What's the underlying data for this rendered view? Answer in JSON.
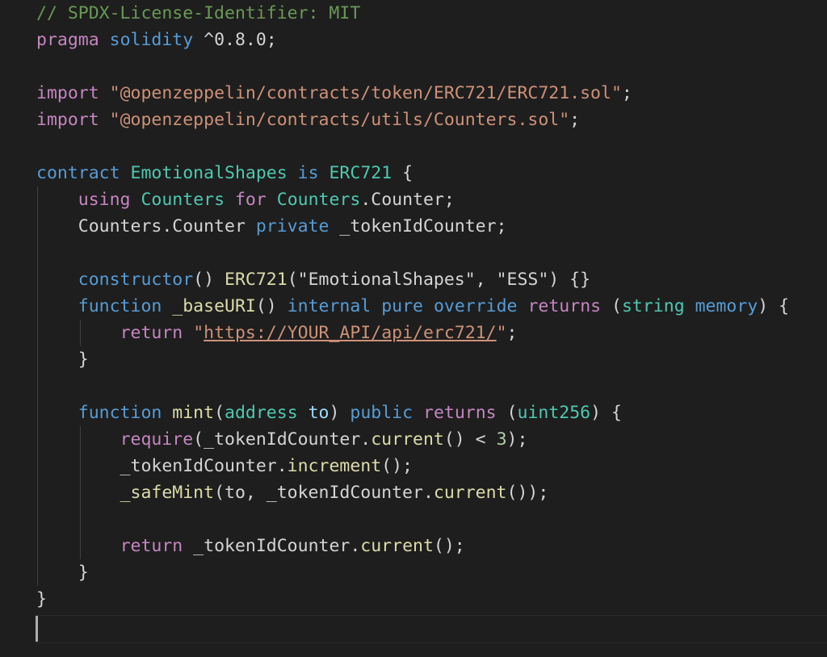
{
  "editor": {
    "language": "solidity",
    "colors": {
      "background": "#1e1e1e",
      "comment": "#6a9955",
      "keyword": "#c586c0",
      "storage": "#569cd6",
      "type": "#4ec9b0",
      "function": "#dcdcaa",
      "string": "#ce9178",
      "number": "#b5cea8",
      "variable": "#9cdcfe",
      "plain": "#d4d4d4"
    },
    "lines": [
      [
        [
          "cm",
          "// SPDX-License-Identifier: MIT"
        ]
      ],
      [
        [
          "kw",
          "pragma"
        ],
        [
          "pl",
          " "
        ],
        [
          "bl",
          "solidity"
        ],
        [
          "pl",
          " ^0.8.0;"
        ]
      ],
      [],
      [
        [
          "kw",
          "import"
        ],
        [
          "pl",
          " "
        ],
        [
          "st",
          "\"@openzeppelin/contracts/token/ERC721/ERC721.sol\""
        ],
        [
          "pl",
          ";"
        ]
      ],
      [
        [
          "kw",
          "import"
        ],
        [
          "pl",
          " "
        ],
        [
          "st",
          "\"@openzeppelin/contracts/utils/Counters.sol\""
        ],
        [
          "pl",
          ";"
        ]
      ],
      [],
      [
        [
          "bl",
          "contract"
        ],
        [
          "pl",
          " "
        ],
        [
          "ty",
          "EmotionalShapes"
        ],
        [
          "pl",
          " "
        ],
        [
          "bl",
          "is"
        ],
        [
          "pl",
          " "
        ],
        [
          "ty",
          "ERC721"
        ],
        [
          "pl",
          " {"
        ]
      ],
      [
        [
          "pl",
          "    "
        ],
        [
          "kw",
          "using"
        ],
        [
          "pl",
          " "
        ],
        [
          "ty",
          "Counters"
        ],
        [
          "pl",
          " "
        ],
        [
          "kw",
          "for"
        ],
        [
          "pl",
          " "
        ],
        [
          "ty",
          "Counters"
        ],
        [
          "pl",
          ".Counter;"
        ]
      ],
      [
        [
          "pl",
          "    Counters.Counter "
        ],
        [
          "bl",
          "private"
        ],
        [
          "pl",
          " _tokenIdCounter;"
        ]
      ],
      [],
      [
        [
          "pl",
          "    "
        ],
        [
          "bl",
          "constructor"
        ],
        [
          "pl",
          "() "
        ],
        [
          "fn",
          "ERC721"
        ],
        [
          "pl",
          "(\"EmotionalShapes\", \"ESS\") {}"
        ]
      ],
      [
        [
          "pl",
          "    "
        ],
        [
          "bl",
          "function"
        ],
        [
          "pl",
          " "
        ],
        [
          "fn",
          "_baseURI"
        ],
        [
          "pl",
          "() "
        ],
        [
          "bl",
          "internal"
        ],
        [
          "pl",
          " "
        ],
        [
          "bl",
          "pure"
        ],
        [
          "pl",
          " "
        ],
        [
          "bl",
          "override"
        ],
        [
          "pl",
          " "
        ],
        [
          "kw",
          "returns"
        ],
        [
          "pl",
          " ("
        ],
        [
          "ty",
          "string"
        ],
        [
          "pl",
          " "
        ],
        [
          "bl",
          "memory"
        ],
        [
          "pl",
          ") {"
        ]
      ],
      [
        [
          "pl",
          "        "
        ],
        [
          "kw",
          "return"
        ],
        [
          "pl",
          " "
        ],
        [
          "st",
          "\""
        ],
        [
          "st ul",
          "https://YOUR_API/api/erc721/"
        ],
        [
          "st",
          "\""
        ],
        [
          "pl",
          ";"
        ]
      ],
      [
        [
          "pl",
          "    }"
        ]
      ],
      [],
      [
        [
          "pl",
          "    "
        ],
        [
          "bl",
          "function"
        ],
        [
          "pl",
          " "
        ],
        [
          "fn",
          "mint"
        ],
        [
          "pl",
          "("
        ],
        [
          "ty",
          "address"
        ],
        [
          "pl",
          " "
        ],
        [
          "va",
          "to"
        ],
        [
          "pl",
          ") "
        ],
        [
          "bl",
          "public"
        ],
        [
          "pl",
          " "
        ],
        [
          "kw",
          "returns"
        ],
        [
          "pl",
          " ("
        ],
        [
          "ty",
          "uint256"
        ],
        [
          "pl",
          ") {"
        ]
      ],
      [
        [
          "pl",
          "        "
        ],
        [
          "kw",
          "require"
        ],
        [
          "pl",
          "(_tokenIdCounter."
        ],
        [
          "fn",
          "current"
        ],
        [
          "pl",
          "() < "
        ],
        [
          "nu",
          "3"
        ],
        [
          "pl",
          ");"
        ]
      ],
      [
        [
          "pl",
          "        _tokenIdCounter."
        ],
        [
          "fn",
          "increment"
        ],
        [
          "pl",
          "();"
        ]
      ],
      [
        [
          "pl",
          "        "
        ],
        [
          "fn",
          "_safeMint"
        ],
        [
          "pl",
          "(to, _tokenIdCounter."
        ],
        [
          "fn",
          "current"
        ],
        [
          "pl",
          "());"
        ]
      ],
      [],
      [
        [
          "pl",
          "        "
        ],
        [
          "kw",
          "return"
        ],
        [
          "pl",
          " _tokenIdCounter."
        ],
        [
          "fn",
          "current"
        ],
        [
          "pl",
          "();"
        ]
      ],
      [
        [
          "pl",
          "    }"
        ]
      ],
      [
        [
          "pl",
          "}"
        ]
      ],
      []
    ]
  }
}
